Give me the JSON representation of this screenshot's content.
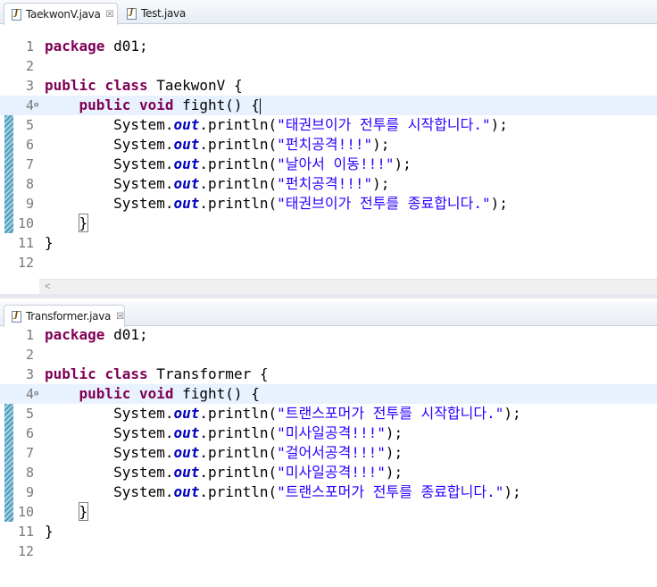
{
  "top_editor": {
    "tabs": [
      {
        "label": "TaekwonV.java",
        "icon": "java-file-icon",
        "close": "☒",
        "active": true
      },
      {
        "label": "Test.java",
        "icon": "java-file-icon",
        "active": false
      }
    ],
    "lines": [
      {
        "n": "1",
        "parts": [
          {
            "t": "kw",
            "v": "package"
          },
          {
            "t": "",
            "v": " d01;"
          }
        ]
      },
      {
        "n": "2",
        "parts": []
      },
      {
        "n": "3",
        "parts": [
          {
            "t": "kw",
            "v": "public"
          },
          {
            "t": "",
            "v": " "
          },
          {
            "t": "kw",
            "v": "class"
          },
          {
            "t": "",
            "v": " TaekwonV {"
          }
        ]
      },
      {
        "n": "4",
        "fold": "⊖",
        "current": true,
        "caret": true,
        "parts": [
          {
            "t": "",
            "v": "    "
          },
          {
            "t": "kw",
            "v": "public"
          },
          {
            "t": "",
            "v": " "
          },
          {
            "t": "kw",
            "v": "void"
          },
          {
            "t": "",
            "v": " fight() {"
          }
        ]
      },
      {
        "n": "5",
        "parts": [
          {
            "t": "",
            "v": "        System."
          },
          {
            "t": "field",
            "v": "out"
          },
          {
            "t": "",
            "v": ".println("
          },
          {
            "t": "str",
            "v": "\"태권브이가 전투를 시작합니다.\""
          },
          {
            "t": "",
            "v": ");"
          }
        ]
      },
      {
        "n": "6",
        "parts": [
          {
            "t": "",
            "v": "        System."
          },
          {
            "t": "field",
            "v": "out"
          },
          {
            "t": "",
            "v": ".println("
          },
          {
            "t": "str",
            "v": "\"펀치공격!!!\""
          },
          {
            "t": "",
            "v": ");"
          }
        ]
      },
      {
        "n": "7",
        "parts": [
          {
            "t": "",
            "v": "        System."
          },
          {
            "t": "field",
            "v": "out"
          },
          {
            "t": "",
            "v": ".println("
          },
          {
            "t": "str",
            "v": "\"날아서 이동!!!\""
          },
          {
            "t": "",
            "v": ");"
          }
        ]
      },
      {
        "n": "8",
        "parts": [
          {
            "t": "",
            "v": "        System."
          },
          {
            "t": "field",
            "v": "out"
          },
          {
            "t": "",
            "v": ".println("
          },
          {
            "t": "str",
            "v": "\"펀치공격!!!\""
          },
          {
            "t": "",
            "v": ");"
          }
        ]
      },
      {
        "n": "9",
        "parts": [
          {
            "t": "",
            "v": "        System."
          },
          {
            "t": "field",
            "v": "out"
          },
          {
            "t": "",
            "v": ".println("
          },
          {
            "t": "str",
            "v": "\"태권브이가 전투를 종료합니다.\""
          },
          {
            "t": "",
            "v": ");"
          }
        ]
      },
      {
        "n": "10",
        "parts": [
          {
            "t": "",
            "v": "    "
          },
          {
            "t": "match",
            "v": "}"
          }
        ]
      },
      {
        "n": "11",
        "parts": [
          {
            "t": "",
            "v": "}"
          }
        ]
      },
      {
        "n": "12",
        "parts": []
      }
    ],
    "scroll_left_arrow": "<"
  },
  "bottom_editor": {
    "tabs": [
      {
        "label": "Transformer.java",
        "icon": "java-file-icon",
        "close": "☒",
        "active": true
      }
    ],
    "lines": [
      {
        "n": "1",
        "parts": [
          {
            "t": "kw",
            "v": "package"
          },
          {
            "t": "",
            "v": " d01;"
          }
        ]
      },
      {
        "n": "2",
        "parts": []
      },
      {
        "n": "3",
        "parts": [
          {
            "t": "kw",
            "v": "public"
          },
          {
            "t": "",
            "v": " "
          },
          {
            "t": "kw",
            "v": "class"
          },
          {
            "t": "",
            "v": " Transformer {"
          }
        ]
      },
      {
        "n": "4",
        "fold": "⊖",
        "current": true,
        "parts": [
          {
            "t": "",
            "v": "    "
          },
          {
            "t": "kw",
            "v": "public"
          },
          {
            "t": "",
            "v": " "
          },
          {
            "t": "kw",
            "v": "void"
          },
          {
            "t": "",
            "v": " fight() {"
          }
        ]
      },
      {
        "n": "5",
        "parts": [
          {
            "t": "",
            "v": "        System."
          },
          {
            "t": "field",
            "v": "out"
          },
          {
            "t": "",
            "v": ".println("
          },
          {
            "t": "str",
            "v": "\"트랜스포머가 전투를 시작합니다.\""
          },
          {
            "t": "",
            "v": ");"
          }
        ]
      },
      {
        "n": "6",
        "parts": [
          {
            "t": "",
            "v": "        System."
          },
          {
            "t": "field",
            "v": "out"
          },
          {
            "t": "",
            "v": ".println("
          },
          {
            "t": "str",
            "v": "\"미사일공격!!!\""
          },
          {
            "t": "",
            "v": ");"
          }
        ]
      },
      {
        "n": "7",
        "parts": [
          {
            "t": "",
            "v": "        System."
          },
          {
            "t": "field",
            "v": "out"
          },
          {
            "t": "",
            "v": ".println("
          },
          {
            "t": "str",
            "v": "\"걸어서공격!!!\""
          },
          {
            "t": "",
            "v": ");"
          }
        ]
      },
      {
        "n": "8",
        "parts": [
          {
            "t": "",
            "v": "        System."
          },
          {
            "t": "field",
            "v": "out"
          },
          {
            "t": "",
            "v": ".println("
          },
          {
            "t": "str",
            "v": "\"미사일공격!!!\""
          },
          {
            "t": "",
            "v": ");"
          }
        ]
      },
      {
        "n": "9",
        "parts": [
          {
            "t": "",
            "v": "        System."
          },
          {
            "t": "field",
            "v": "out"
          },
          {
            "t": "",
            "v": ".println("
          },
          {
            "t": "str",
            "v": "\"트랜스포머가 전투를 종료합니다.\""
          },
          {
            "t": "",
            "v": ");"
          }
        ]
      },
      {
        "n": "10",
        "parts": [
          {
            "t": "",
            "v": "    "
          },
          {
            "t": "match",
            "v": "}"
          }
        ]
      },
      {
        "n": "11",
        "parts": [
          {
            "t": "",
            "v": "}"
          }
        ]
      },
      {
        "n": "12",
        "parts": []
      }
    ]
  },
  "colors": {
    "keyword": "#7f0055",
    "static_field": "#0000c0",
    "string": "#2a00ff",
    "current_line": "#e8f2fe",
    "change_bar": "#4f9db9"
  }
}
